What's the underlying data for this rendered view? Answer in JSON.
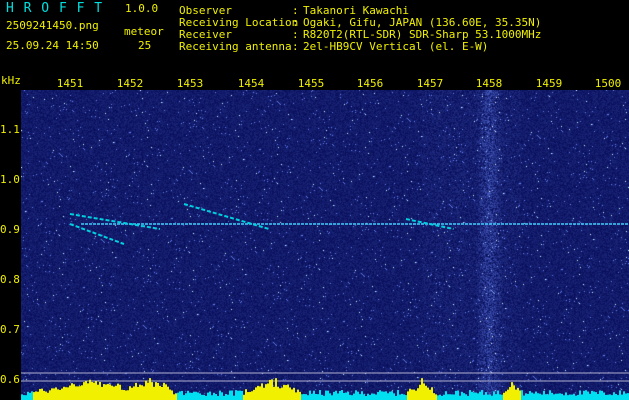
{
  "header": {
    "app_name": "H R O F F T",
    "version": "1.0.0",
    "filename": "2509241450.png",
    "datetime": "25.09.24 14:50",
    "meteor_label": "meteor",
    "meteor_count": "25",
    "info": [
      {
        "label": "Observer",
        "sep": ":",
        "value": "Takanori Kawachi"
      },
      {
        "label": "Receiving Location",
        "sep": ":",
        "value": "Ogaki, Gifu, JAPAN (136.60E, 35.35N)"
      },
      {
        "label": "Receiver",
        "sep": ":",
        "value": "R820T2(RTL-SDR) SDR-Sharp 53.1000MHz"
      },
      {
        "label": "Receiving antenna",
        "sep": ":",
        "value": "2el-HB9CV Vertical (el. E-W)"
      }
    ]
  },
  "axes": {
    "y_unit": "kHz",
    "x_ticks": [
      "1451",
      "1452",
      "1453",
      "1454",
      "1455",
      "1456",
      "1457",
      "1458",
      "1459",
      "1500"
    ],
    "y_ticks": [
      "1.1",
      "1.0",
      "0.9",
      "0.8",
      "0.7",
      "0.6"
    ]
  },
  "colors": {
    "label": "#f0f000",
    "info": "#00e0e0",
    "background": "#070d58",
    "trace": "#00d0e0",
    "carrier": "#40d0ff"
  },
  "chart_data": {
    "type": "heatmap",
    "x_ticks": [
      "1451",
      "1452",
      "1453",
      "1454",
      "1455",
      "1456",
      "1457",
      "1458",
      "1459",
      "1500"
    ],
    "y_unit": "kHz",
    "y_ticks": [
      1.1,
      1.0,
      0.9,
      0.8,
      0.7,
      0.6
    ],
    "ylim": [
      0.58,
      1.2
    ],
    "carrier_khz": 0.91,
    "meteor_traces": [
      {
        "x_start": "1451",
        "x_end": "1452.5",
        "y_start": 0.93,
        "y_end": 0.9
      },
      {
        "x_start": "1451",
        "x_end": "1451.9",
        "y_start": 0.91,
        "y_end": 0.87
      },
      {
        "x_start": "1452.9",
        "x_end": "1454.3",
        "y_start": 0.95,
        "y_end": 0.9
      },
      {
        "x_start": "1456.6",
        "x_end": "1457.4",
        "y_start": 0.92,
        "y_end": 0.9
      }
    ]
  }
}
